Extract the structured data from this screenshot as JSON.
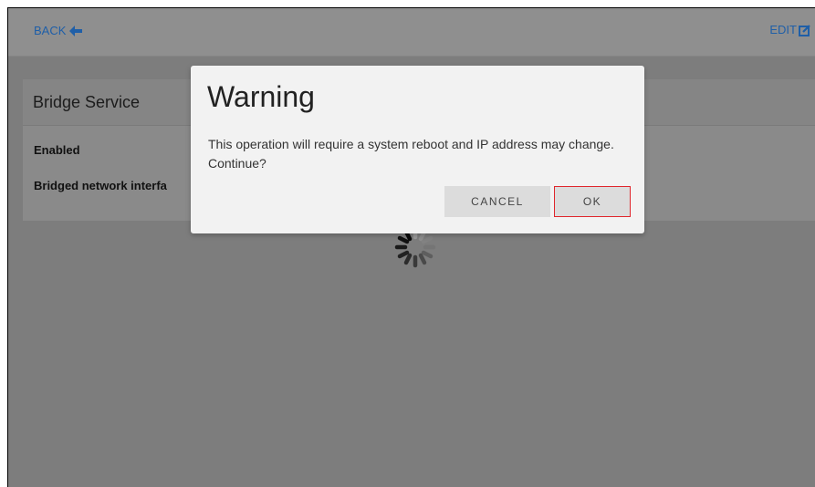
{
  "topbar": {
    "back_label": "BACK",
    "back_icon": "arrow-left-icon",
    "edit_label": "EDIT",
    "edit_icon": "edit-square-icon",
    "link_color": "#1f5fa8"
  },
  "panel": {
    "title": "Bridge Service",
    "fields": [
      {
        "label": "Enabled"
      },
      {
        "label": "Bridged network interfa"
      }
    ]
  },
  "modal": {
    "title": "Warning",
    "message": "This operation will require a system reboot and IP address may change. Continue?",
    "cancel_label": "CANCEL",
    "ok_label": "OK",
    "ok_highlight_color": "#e0262c"
  },
  "overlay": {
    "spinner_icon": "loading-spinner-icon"
  }
}
